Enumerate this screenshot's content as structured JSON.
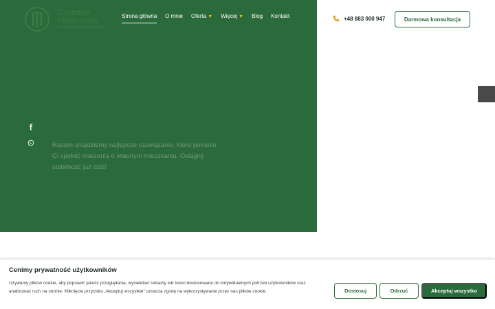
{
  "brand": {
    "logo_line1": "Doradca",
    "logo_line2": "Finansowy",
    "logo_icon": "logo-mark-icon"
  },
  "nav": {
    "items": [
      {
        "label": "Strona główna",
        "active": true,
        "dropdown": false
      },
      {
        "label": "O mnie",
        "active": false,
        "dropdown": false
      },
      {
        "label": "Oferta",
        "active": false,
        "dropdown": true
      },
      {
        "label": "Więcej",
        "active": false,
        "dropdown": true
      },
      {
        "label": "Blog",
        "active": false,
        "dropdown": false
      },
      {
        "label": "Kontakt",
        "active": false,
        "dropdown": false
      }
    ],
    "dropdown_caret": "▼"
  },
  "header": {
    "phone": "+48 883 000 947",
    "phone_icon": "phone-icon",
    "cta_label": "Darmowa konsultacja"
  },
  "hero": {
    "text": "Razem znajdziemy najlepsze rozwiązanie, które pomoże Ci spełnić marzenia o własnym mieszkaniu. Osiągnij stabilność już dziś!",
    "social_icons": [
      "facebook-icon",
      "whatsapp-icon"
    ]
  },
  "cookie": {
    "title": "Cenimy prywatność użytkowników",
    "body": "Używamy plików cookie, aby poprawić jakość przeglądania, wyświetlać reklamy lub treści dostosowane do indywidualnych potrzeb użytkowników oraz analizować ruch na stronie. Kliknięcie przycisku „Akceptuj wszystkie” oznacza zgodę na wykorzystywanie przez nas plików cookie.",
    "customize_label": "Dostosuj",
    "reject_label": "Odrzuć",
    "accept_label": "Akceptuj wszystko"
  },
  "colors": {
    "brand_green": "#2b6a3a",
    "accent_yellow": "#f0c400",
    "hero_text": "#6e9b77"
  }
}
